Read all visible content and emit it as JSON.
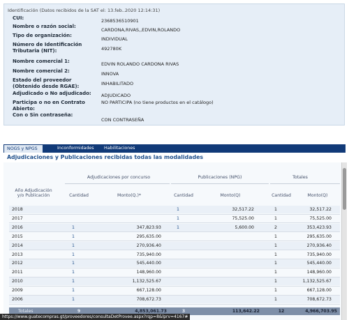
{
  "identification": {
    "title": "Identificación (Datos recibidos de la SAT el: 13.feb..2020 12:14:31)",
    "fields": [
      {
        "label": "CUI:",
        "value": "2368536510901"
      },
      {
        "label": "Nombre o razón social:",
        "value": "CARDONA,RIVAS,,EDVIN,ROLANDO"
      },
      {
        "label": "Tipo de organización:",
        "value": "INDIVIDUAL"
      },
      {
        "label": "Número de Identificación Tributaria (NIT):",
        "value": "492780K"
      },
      {
        "label": "Nombre comercial 1:",
        "value": "EDVIN ROLANDO CARDONA RIVAS"
      },
      {
        "label": "Nombre comercial 2:",
        "value": "INNOVA"
      },
      {
        "label": "Estado del proveedor (Obtenido desde RGAE):",
        "value": "INHABILITADO"
      },
      {
        "label": "Adjudicado o No adjudicado:",
        "value": "ADJUDICADO"
      },
      {
        "label": "Participa o no en Contrato Abierto:",
        "value": "NO PARTICIPA (no tiene productos en el catálogo)"
      },
      {
        "label": "Con o Sin contraseña:",
        "value": "CON CONTRASEÑA"
      }
    ]
  },
  "tabs": [
    {
      "label": "NOGS y NPGS",
      "active": true
    },
    {
      "label": "Inconformidades",
      "active": false
    },
    {
      "label": "Habilitaciones",
      "active": false
    }
  ],
  "section_title": "Adjudicaciones y Publicaciones recibidas todas las modalidades",
  "table": {
    "group_headers": {
      "concurso": "Adjudicaciones por concurso",
      "npg": "Publicaciones (NPG)",
      "totales": "Totales"
    },
    "columns": {
      "year": "Año Adjudicación y/o Publicación",
      "cantidad1": "Cantidad",
      "monto1": "Monto(Q.)*",
      "cantidad2": "Cantidad",
      "monto2": "Monto(Q)",
      "cantidad3": "Cantidad",
      "monto3": "Monto(Q)"
    },
    "rows": [
      {
        "year": "2018",
        "c1": "",
        "m1": "",
        "c2": "1",
        "m2": "32,517.22",
        "c3": "1",
        "m3": "32,517.22"
      },
      {
        "year": "2017",
        "c1": "",
        "m1": "",
        "c2": "1",
        "m2": "75,525.00",
        "c3": "1",
        "m3": "75,525.00"
      },
      {
        "year": "2016",
        "c1": "1",
        "m1": "347,823.93",
        "c2": "1",
        "m2": "5,600.00",
        "c3": "2",
        "m3": "353,423.93"
      },
      {
        "year": "2015",
        "c1": "1",
        "m1": "295,635.00",
        "c2": "",
        "m2": "",
        "c3": "1",
        "m3": "295,635.00"
      },
      {
        "year": "2014",
        "c1": "1",
        "m1": "270,936.40",
        "c2": "",
        "m2": "",
        "c3": "1",
        "m3": "270,936.40"
      },
      {
        "year": "2013",
        "c1": "1",
        "m1": "735,940.00",
        "c2": "",
        "m2": "",
        "c3": "1",
        "m3": "735,940.00"
      },
      {
        "year": "2012",
        "c1": "1",
        "m1": "545,440.00",
        "c2": "",
        "m2": "",
        "c3": "1",
        "m3": "545,440.00"
      },
      {
        "year": "2011",
        "c1": "1",
        "m1": "148,960.00",
        "c2": "",
        "m2": "",
        "c3": "1",
        "m3": "148,960.00"
      },
      {
        "year": "2010",
        "c1": "1",
        "m1": "1,132,525.67",
        "c2": "",
        "m2": "",
        "c3": "1",
        "m3": "1,132,525.67"
      },
      {
        "year": "2009",
        "c1": "1",
        "m1": "667,128.00",
        "c2": "",
        "m2": "",
        "c3": "1",
        "m3": "667,128.00"
      },
      {
        "year": "2006",
        "c1": "1",
        "m1": "708,672.73",
        "c2": "",
        "m2": "",
        "c3": "1",
        "m3": "708,672.73"
      }
    ],
    "totals": {
      "label": "Totales",
      "c1": "9",
      "m1": "4,853,061.73",
      "c2": "3",
      "m2": "113,642.22",
      "c3": "12",
      "m3": "4,966,703.95"
    }
  },
  "status_bar": {
    "url": "https://www.guatecompras.gt/proveedores/consultaDetProvee.aspx?rqp=8&lprv=4167#"
  }
}
